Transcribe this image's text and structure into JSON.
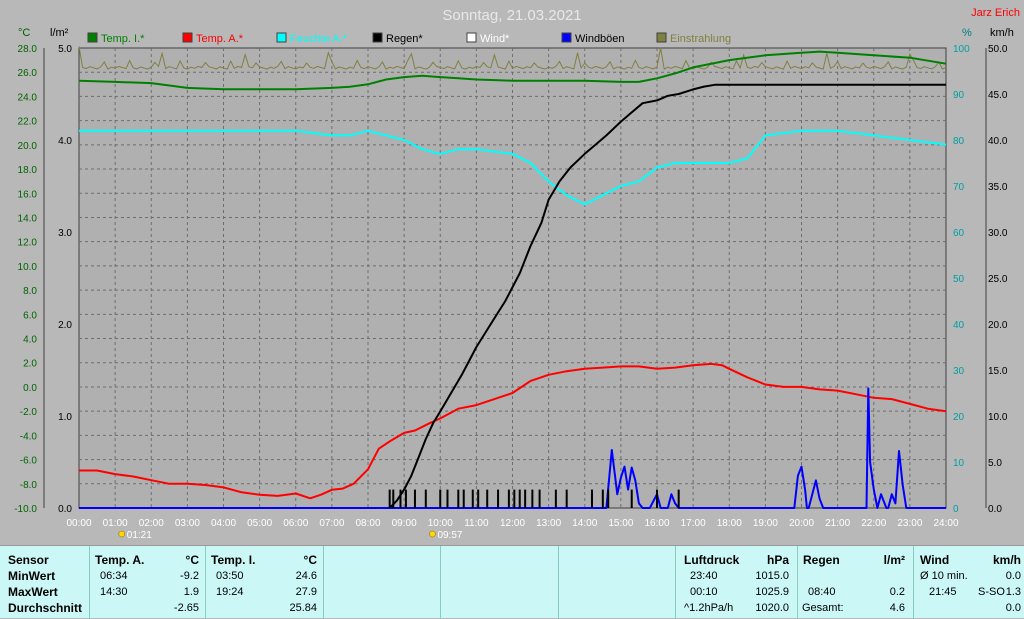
{
  "chart_data": {
    "type": "line",
    "title": "Sonntag, 21.03.2021",
    "brand": "Jarz Erich",
    "x_range": [
      "00:00",
      "24:00"
    ],
    "x_ticks": [
      "00:00",
      "01:00",
      "02:00",
      "03:00",
      "04:00",
      "05:00",
      "06:00",
      "07:00",
      "08:00",
      "09:00",
      "10:00",
      "11:00",
      "12:00",
      "13:00",
      "14:00",
      "15:00",
      "16:00",
      "17:00",
      "18:00",
      "19:00",
      "20:00",
      "21:00",
      "22:00",
      "23:00",
      "24:00"
    ],
    "axes": {
      "temp": {
        "unit": "°C",
        "min": -10,
        "max": 28,
        "ticks": [
          -10,
          -8,
          -6,
          -4,
          -2,
          0,
          2,
          4,
          6,
          8,
          10,
          12,
          14,
          16,
          18,
          20,
          22,
          24,
          26,
          28
        ],
        "color": "#008000"
      },
      "rain": {
        "unit": "l/m²",
        "min": 0,
        "max": 5,
        "ticks": [
          "0.0",
          "1.0",
          "2.0",
          "3.0",
          "4.0",
          "5.0"
        ]
      },
      "humidity": {
        "unit": "%",
        "min": 0,
        "max": 100,
        "ticks": [
          0,
          10,
          20,
          30,
          40,
          50,
          60,
          70,
          80,
          90,
          100
        ],
        "color": "#00b0b0"
      },
      "wind": {
        "unit": "km/h",
        "min": 0,
        "max": 50,
        "ticks": [
          "0.0",
          "5.0",
          "10.0",
          "15.0",
          "20.0",
          "25.0",
          "30.0",
          "35.0",
          "40.0",
          "45.0",
          "50.0"
        ]
      }
    },
    "legend": [
      {
        "name": "Temp. I.*",
        "color": "#008000"
      },
      {
        "name": "Temp. A.*",
        "color": "#ff0000"
      },
      {
        "name": "Feuchte A.*",
        "color": "#00ffff"
      },
      {
        "name": "Regen*",
        "color": "#000000"
      },
      {
        "name": "Wind*",
        "color": "#ffffff"
      },
      {
        "name": "Windböen",
        "color": "#0000ff"
      },
      {
        "name": "Einstrahlung",
        "color": "#808040"
      }
    ],
    "series": [
      {
        "name": "Temp. I.*",
        "axis": "temp",
        "color": "#008000",
        "x": [
          0,
          1,
          2,
          2.5,
          3,
          4,
          5,
          6,
          7,
          7.5,
          8,
          8.5,
          9,
          9.5,
          10,
          10.5,
          11,
          12,
          13,
          14,
          15,
          15.5,
          16,
          16.5,
          17,
          18,
          19,
          20,
          20.5,
          21,
          22,
          23,
          24
        ],
        "y": [
          25.3,
          25.2,
          25.1,
          24.9,
          24.7,
          24.6,
          24.6,
          24.6,
          24.7,
          24.8,
          25.0,
          25.4,
          25.6,
          25.7,
          25.6,
          25.5,
          25.4,
          25.3,
          25.3,
          25.3,
          25.2,
          25.2,
          25.5,
          25.9,
          26.4,
          27.0,
          27.4,
          27.6,
          27.7,
          27.6,
          27.4,
          27.2,
          26.7
        ]
      },
      {
        "name": "Temp. A.*",
        "axis": "temp",
        "color": "#ff0000",
        "x": [
          0,
          0.5,
          1,
          1.5,
          2,
          2.5,
          3,
          3.5,
          4,
          4.5,
          5,
          5.5,
          6,
          6.4,
          6.7,
          7,
          7.3,
          7.6,
          8,
          8.3,
          8.6,
          9,
          9.3,
          9.7,
          10,
          10.5,
          11,
          11.5,
          12,
          12.5,
          13,
          13.5,
          14,
          14.5,
          15,
          15.5,
          16,
          16.5,
          17,
          17.5,
          17.8,
          18,
          18.5,
          19,
          19.5,
          20,
          20.5,
          21,
          21.5,
          22,
          22.5,
          23,
          23.5,
          24
        ],
        "y": [
          -6.9,
          -6.9,
          -7.2,
          -7.4,
          -7.7,
          -8.0,
          -8.0,
          -8.1,
          -8.3,
          -8.7,
          -8.9,
          -9.0,
          -8.8,
          -9.2,
          -8.9,
          -8.5,
          -8.4,
          -8.0,
          -6.8,
          -5.1,
          -4.5,
          -3.8,
          -3.6,
          -3.0,
          -2.6,
          -1.8,
          -1.5,
          -1.0,
          -0.5,
          0.5,
          1.0,
          1.3,
          1.5,
          1.6,
          1.7,
          1.7,
          1.5,
          1.6,
          1.8,
          1.9,
          1.8,
          1.5,
          0.8,
          0.2,
          0,
          0,
          -0.2,
          -0.3,
          -0.6,
          -0.9,
          -1.0,
          -1.4,
          -1.8,
          -2.0
        ]
      },
      {
        "name": "Feuchte A.*",
        "axis": "humidity",
        "color": "#00ffff",
        "x": [
          0,
          1,
          2,
          3,
          4,
          5,
          6,
          7,
          7.5,
          8,
          8.5,
          9,
          9.5,
          10,
          10.5,
          11,
          12,
          12.5,
          13,
          13.5,
          14,
          14.5,
          15,
          15.5,
          16,
          16.5,
          17,
          18,
          18.5,
          19,
          20,
          21,
          22,
          23,
          24
        ],
        "y": [
          82,
          82,
          82,
          82,
          82,
          82,
          82,
          81,
          81,
          82,
          81,
          80,
          78,
          77,
          78,
          78,
          77,
          75,
          71,
          68,
          66,
          68,
          70,
          71,
          74,
          75,
          75,
          75,
          76,
          81,
          82,
          82,
          81,
          80,
          79
        ]
      },
      {
        "name": "Regen*",
        "axis": "rain",
        "color": "#000000",
        "x": [
          0,
          8.6,
          8.8,
          9.0,
          9.2,
          9.4,
          9.6,
          9.8,
          10.0,
          10.3,
          10.6,
          11.0,
          11.4,
          11.8,
          12.2,
          12.5,
          12.8,
          13.0,
          13.3,
          13.6,
          14.0,
          14.3,
          14.6,
          15.0,
          15.3,
          15.6,
          16.0,
          16.3,
          16.6,
          17.0,
          17.3,
          17.6,
          18.0,
          19,
          20,
          21,
          22,
          23,
          24
        ],
        "y": [
          0,
          0,
          0.08,
          0.2,
          0.35,
          0.55,
          0.75,
          0.92,
          1.05,
          1.25,
          1.45,
          1.75,
          2.0,
          2.25,
          2.55,
          2.85,
          3.1,
          3.35,
          3.55,
          3.7,
          3.85,
          3.95,
          4.05,
          4.2,
          4.3,
          4.4,
          4.43,
          4.48,
          4.5,
          4.55,
          4.58,
          4.6,
          4.6,
          4.6,
          4.6,
          4.6,
          4.6,
          4.6,
          4.6
        ]
      },
      {
        "name": "Windböen",
        "axis": "wind",
        "color": "#0000ff",
        "x": [
          0,
          14.6,
          14.75,
          14.9,
          15.0,
          15.1,
          15.2,
          15.3,
          15.4,
          15.5,
          15.6,
          15.8,
          16.0,
          16.1,
          16.2,
          16.3,
          16.4,
          16.5,
          16.6,
          19.8,
          19.9,
          20.0,
          20.1,
          20.15,
          20.2,
          20.3,
          20.4,
          20.5,
          20.6,
          21.7,
          21.8,
          21.85,
          21.9,
          22.0,
          22.1,
          22.2,
          22.3,
          22.35,
          22.4,
          22.5,
          22.6,
          22.7,
          22.8,
          22.9,
          23.0,
          24
        ],
        "y": [
          0,
          0,
          6.3,
          1.5,
          3.3,
          4.5,
          2.0,
          4.4,
          3.0,
          0.5,
          0,
          0,
          1.5,
          0,
          0,
          0,
          1.5,
          0.5,
          0,
          0,
          3.5,
          4.5,
          2.0,
          0,
          0,
          1.5,
          3.0,
          1.0,
          0,
          0,
          0,
          13.0,
          5.0,
          2.0,
          0,
          1.5,
          0.5,
          0,
          0,
          1.5,
          0.5,
          6.2,
          2.5,
          0,
          0,
          0
        ]
      },
      {
        "name": "Regen-Ereignisse",
        "axis": "rain",
        "color": "#000000",
        "type": "bar",
        "x": [
          8.6,
          8.7,
          8.9,
          9.05,
          9.3,
          9.6,
          10.0,
          10.2,
          10.5,
          10.65,
          10.9,
          11.05,
          11.3,
          11.6,
          11.9,
          12.05,
          12.2,
          12.35,
          12.55,
          12.75,
          13.2,
          13.5,
          14.2,
          14.5,
          14.65,
          15.3,
          16.0,
          16.6
        ],
        "y": [
          0.2,
          0.2,
          0.2,
          0.2,
          0.2,
          0.2,
          0.2,
          0.2,
          0.2,
          0.2,
          0.2,
          0.2,
          0.2,
          0.2,
          0.2,
          0.2,
          0.2,
          0.2,
          0.2,
          0.2,
          0.2,
          0.2,
          0.2,
          0.2,
          0.2,
          0.2,
          0.2,
          0.2
        ]
      },
      {
        "name": "Einstrahlung",
        "axis": "humidity",
        "color": "#808040",
        "type": "band",
        "y": 96
      }
    ],
    "annotations": [
      {
        "time": "01:21",
        "x": 1.35
      },
      {
        "time": "09:57",
        "x": 9.95
      }
    ]
  },
  "stats": {
    "sensor": {
      "header": "Sensor",
      "rows": [
        "MinWert",
        "MaxWert",
        "Durchschnitt"
      ]
    },
    "temp_a": {
      "header": "Temp. A.",
      "unit": "°C",
      "min_time": "06:34",
      "min_val": "-9.2",
      "max_time": "14:30",
      "max_val": "1.9",
      "avg": "-2.65"
    },
    "temp_i": {
      "header": "Temp. I.",
      "unit": "°C",
      "min_time": "03:50",
      "min_val": "24.6",
      "max_time": "19:24",
      "max_val": "27.9",
      "avg": "25.84"
    },
    "luftdruck": {
      "header": "Luftdruck",
      "unit": "hPa",
      "min_time": "23:40",
      "min_val": "1015.0",
      "max_time": "00:10",
      "max_val": "1025.9",
      "trend": "^1.2hPa/h",
      "trend_val": "1020.0"
    },
    "regen": {
      "header": "Regen",
      "unit": "l/m²",
      "max_time": "08:40",
      "max_val": "0.2",
      "total_label": "Gesamt:",
      "total_val": "4.6"
    },
    "wind": {
      "header": "Wind",
      "unit": "km/h",
      "avg_label": "Ø 10 min.",
      "avg_val": "0.0",
      "max_time": "21:45",
      "max_dir": "S-SO",
      "max_val": "1.3",
      "avg2": "0.0"
    }
  }
}
